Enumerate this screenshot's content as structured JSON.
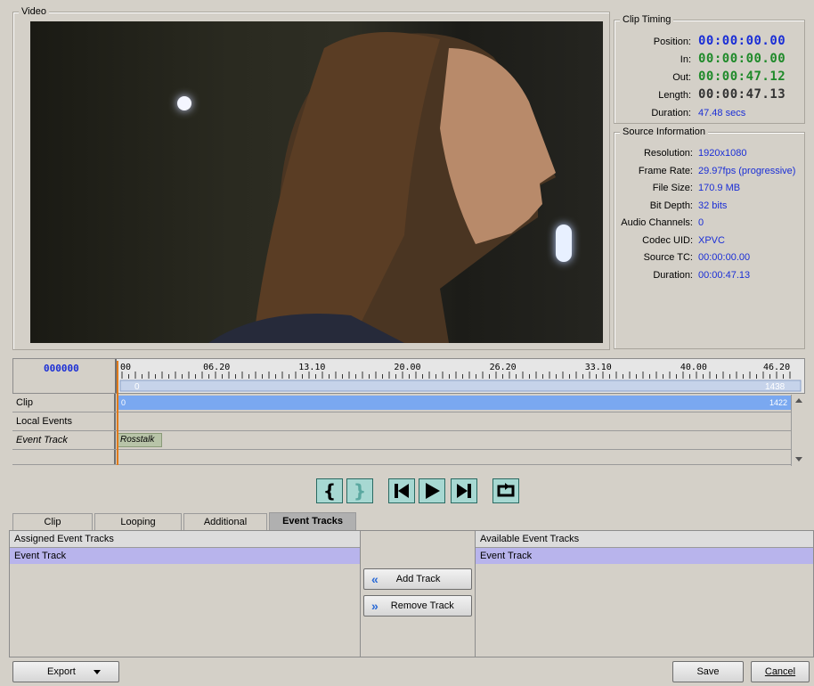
{
  "video": {
    "group_title": "Video"
  },
  "clip_timing": {
    "group_title": "Clip Timing",
    "rows": [
      {
        "label": "Position:",
        "value": "00:00:00.00",
        "color": "#1a2ed6"
      },
      {
        "label": "In:",
        "value": "00:00:00.00",
        "color": "#1f8a2a"
      },
      {
        "label": "Out:",
        "value": "00:00:47.12",
        "color": "#1f8a2a"
      },
      {
        "label": "Length:",
        "value": "00:00:47.13",
        "color": "#333333"
      },
      {
        "label": "Duration:",
        "value": "47.48 secs",
        "color": "#1a2ed6"
      }
    ]
  },
  "source_info": {
    "group_title": "Source Information",
    "rows": [
      {
        "label": "Resolution:",
        "value": "1920x1080"
      },
      {
        "label": "Frame Rate:",
        "value": "29.97fps (progressive)"
      },
      {
        "label": "File Size:",
        "value": "170.9 MB"
      },
      {
        "label": "Bit Depth:",
        "value": "32 bits"
      },
      {
        "label": "Audio Channels:",
        "value": "0"
      },
      {
        "label": "Codec UID:",
        "value": "XPVC"
      },
      {
        "label": "Source TC:",
        "value": "00:00:00.00"
      },
      {
        "label": "Duration:",
        "value": "00:00:47.13"
      }
    ]
  },
  "timeline": {
    "frame_counter": "000000",
    "ruler_labels": [
      "00",
      "06.20",
      "13.10",
      "20.00",
      "26.20",
      "33.10",
      "40.00",
      "46.20"
    ],
    "range_start": "0",
    "range_end": "1438",
    "tracks": [
      {
        "label": "Clip",
        "start": "0",
        "end": "1422"
      },
      {
        "label": "Local Events"
      },
      {
        "label": "Event Track",
        "event": "Rosstalk"
      },
      {
        "label": ""
      }
    ]
  },
  "transport": {
    "buttons": [
      "mark-in-icon",
      "mark-out-icon",
      "go-start-icon",
      "play-icon",
      "go-end-icon",
      "loop-icon"
    ]
  },
  "tabs": [
    {
      "label": "Clip",
      "active": false
    },
    {
      "label": "Looping",
      "active": false
    },
    {
      "label": "Additional",
      "active": false
    },
    {
      "label": "Event Tracks",
      "active": true
    }
  ],
  "assigned": {
    "header": "Assigned Event Tracks",
    "items": [
      "Event Track"
    ]
  },
  "available": {
    "header": "Available Event Tracks",
    "items": [
      "Event Track"
    ]
  },
  "actions": {
    "add_track": "Add Track",
    "remove_track": "Remove Track"
  },
  "footer": {
    "export": "Export",
    "save": "Save",
    "cancel": "Cancel"
  },
  "colors": {
    "accent_blue": "#1a2ed6",
    "green": "#1f8a2a",
    "selection": "#b8b4ec",
    "clip_bar": "#7aa8f0"
  }
}
